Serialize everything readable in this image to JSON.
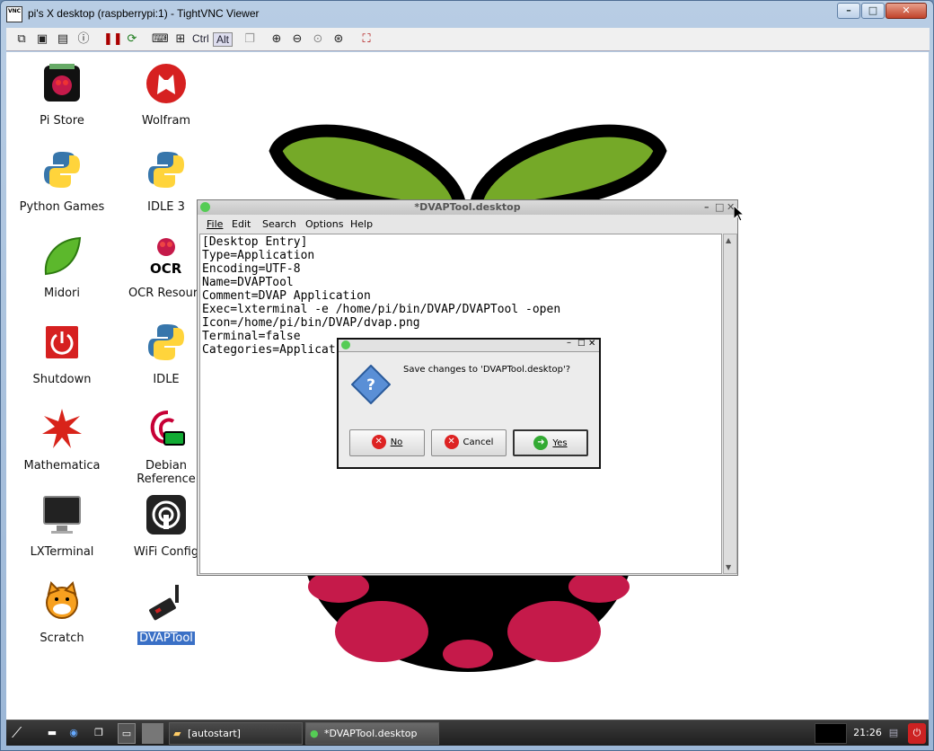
{
  "window": {
    "title": "pi's X desktop (raspberrypi:1) - TightVNC Viewer",
    "icon": "vnc-icon",
    "vnc_icon_text": "VNC"
  },
  "toolbar": {
    "items": [
      "new-connection-icon",
      "save-icon",
      "options-icon",
      "info-icon",
      "pause-icon",
      "refresh-icon",
      "ctrl-alt-del-icon",
      "ctrl-esc-icon"
    ],
    "ctrl_label": "Ctrl",
    "alt_label": "Alt"
  },
  "desktop": {
    "icons": [
      {
        "label": "Pi Store"
      },
      {
        "label": "Wolfram"
      },
      {
        "label": "Python Games"
      },
      {
        "label": "IDLE 3"
      },
      {
        "label": "Midori"
      },
      {
        "label": "OCR Resourc"
      },
      {
        "label": "Shutdown"
      },
      {
        "label": "IDLE"
      },
      {
        "label": "Mathematica"
      },
      {
        "label": "Debian\nReference"
      },
      {
        "label": "LXTerminal"
      },
      {
        "label": "WiFi Config"
      },
      {
        "label": "Scratch"
      },
      {
        "label": "DVAPTool"
      }
    ],
    "ocr_badge_text": "OCR"
  },
  "editor": {
    "title": "*DVAPTool.desktop",
    "menu": [
      "File",
      "Edit",
      "Search",
      "Options",
      "Help"
    ],
    "content": "[Desktop Entry]\nType=Application\nEncoding=UTF-8\nName=DVAPTool\nComment=DVAP Application\nExec=lxterminal -e /home/pi/bin/DVAP/DVAPTool -open\nIcon=/home/pi/bin/DVAP/dvap.png\nTerminal=false\nCategories=Applicat"
  },
  "dialog": {
    "message": "Save changes to 'DVAPTool.desktop'?",
    "no_label": "No",
    "cancel_label": "Cancel",
    "yes_label": "Yes"
  },
  "taskbar": {
    "tasks": [
      {
        "label": "[autostart]"
      },
      {
        "label": "*DVAPTool.desktop"
      }
    ],
    "clock": "21:26"
  },
  "colors": {
    "selection": "#3a70c6",
    "raspberry_red": "#c51a4a",
    "leaf_green": "#75a928"
  }
}
